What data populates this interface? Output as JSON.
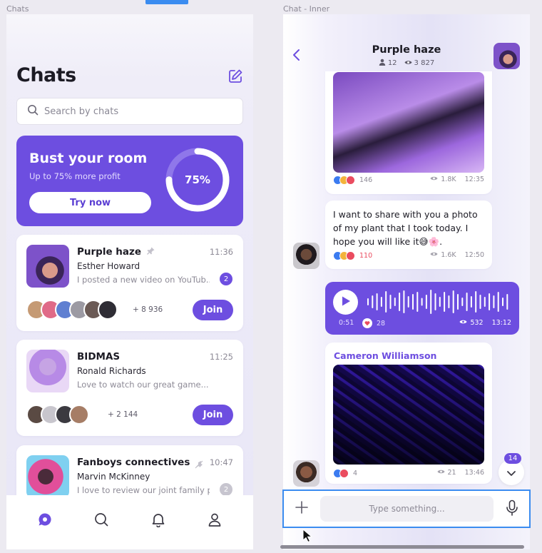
{
  "canvas": {
    "left_frame_label": "Chats",
    "right_frame_label": "Chat - Inner"
  },
  "chats": {
    "title": "Chats",
    "search_placeholder": "Search by chats",
    "promo": {
      "title": "Bust your room",
      "subtitle": "Up to 75% more profit",
      "button": "Try now",
      "percent_label": "75%",
      "percent_value": 0.75
    },
    "items": [
      {
        "name": "Purple haze",
        "time": "11:36",
        "sender": "Esther Howard",
        "message": "I posted a new video on YouTub...",
        "badge": "2",
        "pinned": true,
        "more": "+ 8 936",
        "join": "Join"
      },
      {
        "name": "BIDMAS",
        "time": "11:25",
        "sender": "Ronald Richards",
        "message": "Love to watch our great game...",
        "more": "+ 2 144",
        "join": "Join"
      },
      {
        "name": "Fanboys connectives",
        "time": "10:47",
        "sender": "Marvin McKinney",
        "message": "I love to review our joint family p...",
        "badge": "2",
        "muted": true
      }
    ],
    "tabs": [
      "chats-tab",
      "search-tab",
      "notifications-tab",
      "profile-tab"
    ]
  },
  "room": {
    "title": "Purple haze",
    "members": "12",
    "views": "3 827",
    "messages": [
      {
        "type": "image",
        "reactions_count": "146",
        "views": "1.8K",
        "time": "12:35"
      },
      {
        "type": "text",
        "text": "I want to share with you a photo of my plant that I took today. I hope you will like it😅🌸.",
        "reactions_count": "110",
        "views": "1.6K",
        "time": "12:50"
      },
      {
        "type": "voice",
        "duration": "0:51",
        "likes": "28",
        "views": "532",
        "time": "13:12"
      },
      {
        "type": "image",
        "author": "Cameron Williamson",
        "reactions_count": "4",
        "views": "21",
        "time": "13:46"
      }
    ],
    "unread_count": "14",
    "composer_placeholder": "Type something..."
  },
  "colors": {
    "accent": "#6d4ee0",
    "selection": "#3b8cf0"
  }
}
